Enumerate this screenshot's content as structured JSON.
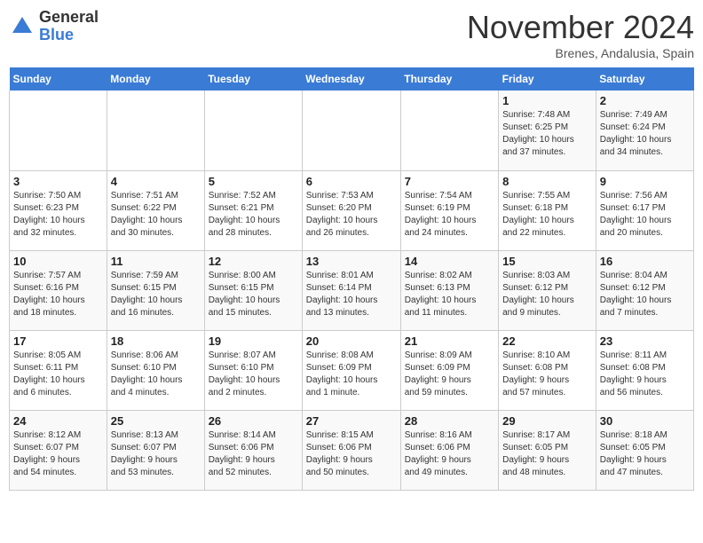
{
  "logo": {
    "general": "General",
    "blue": "Blue"
  },
  "title": "November 2024",
  "location": "Brenes, Andalusia, Spain",
  "days_of_week": [
    "Sunday",
    "Monday",
    "Tuesday",
    "Wednesday",
    "Thursday",
    "Friday",
    "Saturday"
  ],
  "weeks": [
    [
      {
        "day": "",
        "info": ""
      },
      {
        "day": "",
        "info": ""
      },
      {
        "day": "",
        "info": ""
      },
      {
        "day": "",
        "info": ""
      },
      {
        "day": "",
        "info": ""
      },
      {
        "day": "1",
        "info": "Sunrise: 7:48 AM\nSunset: 6:25 PM\nDaylight: 10 hours\nand 37 minutes."
      },
      {
        "day": "2",
        "info": "Sunrise: 7:49 AM\nSunset: 6:24 PM\nDaylight: 10 hours\nand 34 minutes."
      }
    ],
    [
      {
        "day": "3",
        "info": "Sunrise: 7:50 AM\nSunset: 6:23 PM\nDaylight: 10 hours\nand 32 minutes."
      },
      {
        "day": "4",
        "info": "Sunrise: 7:51 AM\nSunset: 6:22 PM\nDaylight: 10 hours\nand 30 minutes."
      },
      {
        "day": "5",
        "info": "Sunrise: 7:52 AM\nSunset: 6:21 PM\nDaylight: 10 hours\nand 28 minutes."
      },
      {
        "day": "6",
        "info": "Sunrise: 7:53 AM\nSunset: 6:20 PM\nDaylight: 10 hours\nand 26 minutes."
      },
      {
        "day": "7",
        "info": "Sunrise: 7:54 AM\nSunset: 6:19 PM\nDaylight: 10 hours\nand 24 minutes."
      },
      {
        "day": "8",
        "info": "Sunrise: 7:55 AM\nSunset: 6:18 PM\nDaylight: 10 hours\nand 22 minutes."
      },
      {
        "day": "9",
        "info": "Sunrise: 7:56 AM\nSunset: 6:17 PM\nDaylight: 10 hours\nand 20 minutes."
      }
    ],
    [
      {
        "day": "10",
        "info": "Sunrise: 7:57 AM\nSunset: 6:16 PM\nDaylight: 10 hours\nand 18 minutes."
      },
      {
        "day": "11",
        "info": "Sunrise: 7:59 AM\nSunset: 6:15 PM\nDaylight: 10 hours\nand 16 minutes."
      },
      {
        "day": "12",
        "info": "Sunrise: 8:00 AM\nSunset: 6:15 PM\nDaylight: 10 hours\nand 15 minutes."
      },
      {
        "day": "13",
        "info": "Sunrise: 8:01 AM\nSunset: 6:14 PM\nDaylight: 10 hours\nand 13 minutes."
      },
      {
        "day": "14",
        "info": "Sunrise: 8:02 AM\nSunset: 6:13 PM\nDaylight: 10 hours\nand 11 minutes."
      },
      {
        "day": "15",
        "info": "Sunrise: 8:03 AM\nSunset: 6:12 PM\nDaylight: 10 hours\nand 9 minutes."
      },
      {
        "day": "16",
        "info": "Sunrise: 8:04 AM\nSunset: 6:12 PM\nDaylight: 10 hours\nand 7 minutes."
      }
    ],
    [
      {
        "day": "17",
        "info": "Sunrise: 8:05 AM\nSunset: 6:11 PM\nDaylight: 10 hours\nand 6 minutes."
      },
      {
        "day": "18",
        "info": "Sunrise: 8:06 AM\nSunset: 6:10 PM\nDaylight: 10 hours\nand 4 minutes."
      },
      {
        "day": "19",
        "info": "Sunrise: 8:07 AM\nSunset: 6:10 PM\nDaylight: 10 hours\nand 2 minutes."
      },
      {
        "day": "20",
        "info": "Sunrise: 8:08 AM\nSunset: 6:09 PM\nDaylight: 10 hours\nand 1 minute."
      },
      {
        "day": "21",
        "info": "Sunrise: 8:09 AM\nSunset: 6:09 PM\nDaylight: 9 hours\nand 59 minutes."
      },
      {
        "day": "22",
        "info": "Sunrise: 8:10 AM\nSunset: 6:08 PM\nDaylight: 9 hours\nand 57 minutes."
      },
      {
        "day": "23",
        "info": "Sunrise: 8:11 AM\nSunset: 6:08 PM\nDaylight: 9 hours\nand 56 minutes."
      }
    ],
    [
      {
        "day": "24",
        "info": "Sunrise: 8:12 AM\nSunset: 6:07 PM\nDaylight: 9 hours\nand 54 minutes."
      },
      {
        "day": "25",
        "info": "Sunrise: 8:13 AM\nSunset: 6:07 PM\nDaylight: 9 hours\nand 53 minutes."
      },
      {
        "day": "26",
        "info": "Sunrise: 8:14 AM\nSunset: 6:06 PM\nDaylight: 9 hours\nand 52 minutes."
      },
      {
        "day": "27",
        "info": "Sunrise: 8:15 AM\nSunset: 6:06 PM\nDaylight: 9 hours\nand 50 minutes."
      },
      {
        "day": "28",
        "info": "Sunrise: 8:16 AM\nSunset: 6:06 PM\nDaylight: 9 hours\nand 49 minutes."
      },
      {
        "day": "29",
        "info": "Sunrise: 8:17 AM\nSunset: 6:05 PM\nDaylight: 9 hours\nand 48 minutes."
      },
      {
        "day": "30",
        "info": "Sunrise: 8:18 AM\nSunset: 6:05 PM\nDaylight: 9 hours\nand 47 minutes."
      }
    ]
  ]
}
